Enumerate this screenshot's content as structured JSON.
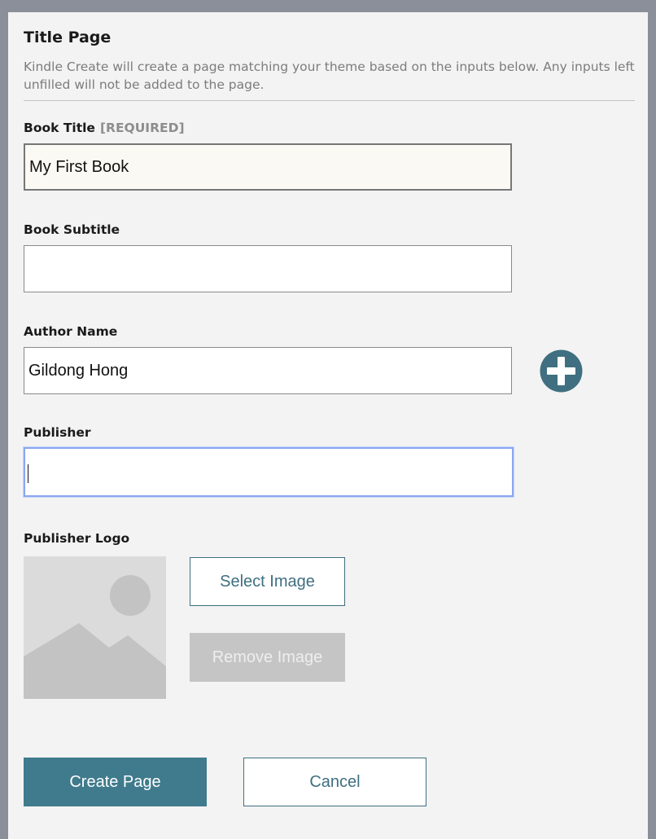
{
  "dialog": {
    "title": "Title Page",
    "description": "Kindle Create will create a page matching your theme based on the inputs below. Any inputs left unfilled will not be added to the page."
  },
  "fields": {
    "book_title": {
      "label": "Book Title",
      "required_tag": "[REQUIRED]",
      "value": "My First Book"
    },
    "book_subtitle": {
      "label": "Book Subtitle",
      "value": ""
    },
    "author_name": {
      "label": "Author Name",
      "value": "Gildong Hong"
    },
    "publisher": {
      "label": "Publisher",
      "value": ""
    }
  },
  "publisher_logo": {
    "label": "Publisher Logo",
    "select_label": "Select Image",
    "remove_label": "Remove Image"
  },
  "actions": {
    "create_label": "Create Page",
    "cancel_label": "Cancel"
  },
  "icons": {
    "add_author": "plus-circle-icon",
    "logo_placeholder": "image-placeholder-icon"
  },
  "colors": {
    "accent": "#3f7b8c",
    "focus_ring": "#8aa7f0",
    "disabled": "#c5c5c5",
    "panel_bg": "#f3f3f3"
  }
}
